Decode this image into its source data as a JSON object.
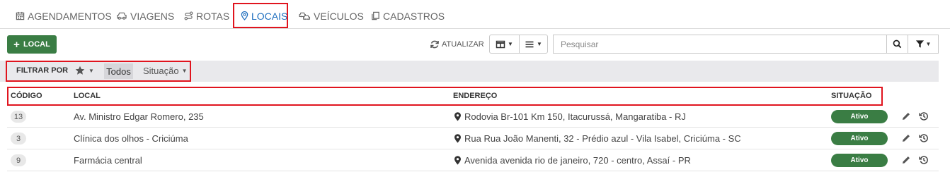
{
  "tabs": [
    {
      "label": "AGENDAMENTOS",
      "icon": "calendar-icon",
      "active": false
    },
    {
      "label": "VIAGENS",
      "icon": "car-icon",
      "active": false
    },
    {
      "label": "ROTAS",
      "icon": "route-icon",
      "active": false
    },
    {
      "label": "LOCAIS",
      "icon": "map-pin-icon",
      "active": true
    },
    {
      "label": "VEÍCULOS",
      "icon": "vehicles-icon",
      "active": false
    },
    {
      "label": "CADASTROS",
      "icon": "copy-icon",
      "active": false
    }
  ],
  "toolbar": {
    "add_label": "LOCAL",
    "refresh_label": "ATUALIZAR",
    "search_placeholder": "Pesquisar",
    "add_color": "#3a7d44"
  },
  "filter": {
    "label": "FILTRAR POR",
    "all_label": "Todos",
    "status_label": "Situação"
  },
  "table": {
    "headers": {
      "code": "CÓDIGO",
      "local": "LOCAL",
      "address": "ENDEREÇO",
      "status": "SITUAÇÃO"
    },
    "rows": [
      {
        "code": "13",
        "local": "Av. Ministro Edgar Romero, 235",
        "address": "Rodovia Br-101 Km 150, Itacurussá, Mangaratiba - RJ",
        "status": "Ativo"
      },
      {
        "code": "3",
        "local": "Clínica dos olhos - Criciúma",
        "address": "Rua Rua João Manenti, 32 - Prédio azul - Vila Isabel, Criciúma - SC",
        "status": "Ativo"
      },
      {
        "code": "9",
        "local": "Farmácia central",
        "address": "Avenida avenida rio de janeiro, 720 - centro, Assaí - PR",
        "status": "Ativo"
      }
    ]
  },
  "colors": {
    "active_tab": "#1f6fbf",
    "status_active": "#3a7d44",
    "highlight": "#e0141e"
  }
}
